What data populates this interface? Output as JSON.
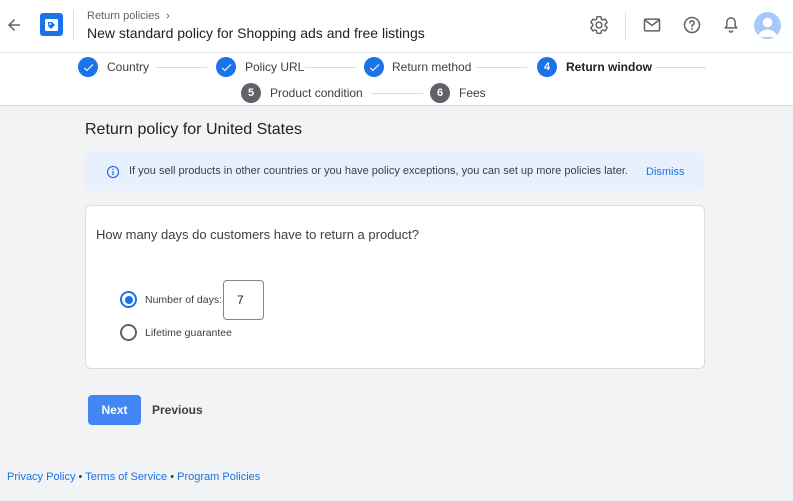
{
  "header": {
    "breadcrumb": "Return policies",
    "title": "New standard policy for Shopping ads and free listings",
    "icons": [
      "arrow-back-icon",
      "merchant-logo-icon",
      "gear-icon",
      "mail-icon",
      "help-icon",
      "bell-icon",
      "avatar"
    ]
  },
  "stepper": {
    "steps": [
      {
        "number": "1",
        "label": "Country",
        "state": "done"
      },
      {
        "number": "2",
        "label": "Policy URL",
        "state": "done"
      },
      {
        "number": "3",
        "label": "Return method",
        "state": "done"
      },
      {
        "number": "4",
        "label": "Return window",
        "state": "active"
      },
      {
        "number": "5",
        "label": "Product condition",
        "state": "todo"
      },
      {
        "number": "6",
        "label": "Fees",
        "state": "todo"
      }
    ]
  },
  "main": {
    "section_title": "Return policy for United States",
    "banner": {
      "text": "If you sell products in other countries or you have policy exceptions, you can set up more policies later.",
      "dismiss_label": "Dismiss"
    },
    "question": "How many days do customers have to return a product?",
    "options": [
      {
        "label": "Number of days:",
        "selected": true
      },
      {
        "label": "Lifetime guarantee",
        "selected": false
      }
    ],
    "days_value": "7"
  },
  "actions": {
    "next_label": "Next",
    "previous_label": "Previous"
  },
  "footer": {
    "links": [
      "Privacy Policy",
      "Terms of Service",
      "Program Policies"
    ],
    "separator": "•"
  },
  "colors": {
    "accent": "#1a73e8",
    "button": "#4285f4",
    "banner_bg": "#e8f0fe",
    "page_bg": "#f1f3f4"
  }
}
